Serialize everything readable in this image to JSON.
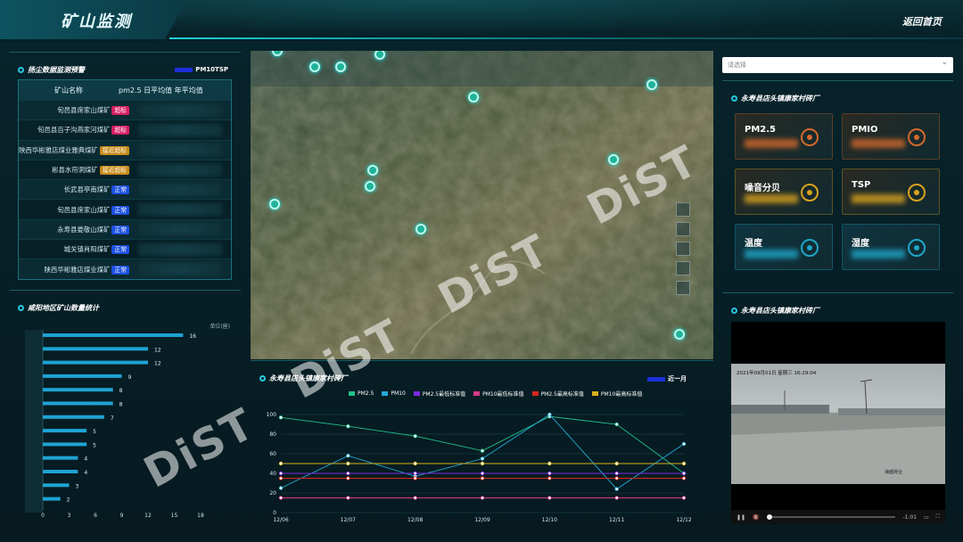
{
  "header": {
    "title": "矿山监测",
    "back_label": "返回首页"
  },
  "dust_panel": {
    "title": "扬尘数据监测预警",
    "legend": "PM10TSP",
    "columns": [
      "矿山名称",
      "pm2.5 日平均值 年平均值"
    ],
    "rows": [
      {
        "name": "旬邑县席家山煤矿",
        "status": "超标",
        "color": "red"
      },
      {
        "name": "旬邑县百子沟燕家河煤矿",
        "status": "超标",
        "color": "red"
      },
      {
        "name": "陕西华彬雅店煤业雅典煤矿",
        "status": "接近超标",
        "color": "gold"
      },
      {
        "name": "彬县水帘洞煤矿",
        "status": "接近超标",
        "color": "gold"
      },
      {
        "name": "长武县亭南煤矿",
        "status": "正常",
        "color": "blue"
      },
      {
        "name": "旬邑县席家山煤矿",
        "status": "正常",
        "color": "blue"
      },
      {
        "name": "永寿县娄敬山煤矿",
        "status": "正常",
        "color": "blue"
      },
      {
        "name": "城关镇肖阳煤矿",
        "status": "正常",
        "color": "blue"
      },
      {
        "name": "陕西华彬雅店煤业煤矿",
        "status": "正常",
        "color": "blue"
      }
    ]
  },
  "count_panel": {
    "title": "咸阳地区矿山数量统计",
    "unit": "单位(座)"
  },
  "line_panel": {
    "title": "永寿县店头镇康家村砖厂",
    "segment": "近一月"
  },
  "select": {
    "placeholder": "请选择"
  },
  "sensor_panel": {
    "title": "永寿县店头镇康家村砖厂",
    "cards": [
      {
        "label": "PM2.5",
        "accent": "#d2692d",
        "icon": "mask-icon"
      },
      {
        "label": "PMIO",
        "accent": "#d2692d",
        "icon": "eye-icon"
      },
      {
        "label": "噪音分贝",
        "accent": "#d9a21e",
        "icon": "sound-icon"
      },
      {
        "label": "TSP",
        "accent": "#d9a21e",
        "icon": "triangle-icon"
      },
      {
        "label": "温度",
        "accent": "#1fa6c9",
        "icon": "thermometer-icon"
      },
      {
        "label": "湿度",
        "accent": "#1fa6c9",
        "icon": "humidity-icon"
      }
    ]
  },
  "video_panel": {
    "title": "永寿县店头镇康家村砖厂",
    "timestamp": "2021年09月01日 星期三 16:29:04",
    "time_label": "-1:01",
    "caption": "海盛砖业"
  },
  "watermark": "DiST",
  "chart_data": [
    {
      "type": "bar",
      "orientation": "horizontal",
      "title": "咸阳地区矿山数量统计",
      "values": [
        16,
        12,
        12,
        9,
        8,
        8,
        7,
        5,
        5,
        4,
        4,
        3,
        2
      ],
      "xticks": [
        0,
        3,
        6,
        9,
        12,
        15,
        18
      ],
      "xlim": [
        0,
        18
      ],
      "unit": "单位(座)"
    },
    {
      "type": "line",
      "title": "永寿县店头镇康家村砖厂",
      "x": [
        "12/06",
        "12/07",
        "12/08",
        "12/09",
        "12/10",
        "12/11",
        "12/12"
      ],
      "ylim": [
        0,
        100
      ],
      "yticks": [
        0,
        20,
        40,
        60,
        80,
        100
      ],
      "series": [
        {
          "name": "PM2.5",
          "color": "#22c08a",
          "values": [
            97,
            88,
            78,
            63,
            98,
            90,
            40
          ]
        },
        {
          "name": "PM10",
          "color": "#25a9d6",
          "values": [
            25,
            58,
            37,
            55,
            100,
            24,
            70
          ]
        },
        {
          "name": "PM2.5最低标准值",
          "color": "#7b2be0",
          "values": [
            40,
            40,
            40,
            40,
            40,
            40,
            40
          ]
        },
        {
          "name": "PM10最低标准值",
          "color": "#d63a8c",
          "values": [
            15,
            15,
            15,
            15,
            15,
            15,
            15
          ]
        },
        {
          "name": "PM2.5最高标准值",
          "color": "#d9261d",
          "values": [
            35,
            35,
            35,
            35,
            35,
            35,
            35
          ]
        },
        {
          "name": "PM10最高标准值",
          "color": "#d6b21a",
          "values": [
            50,
            50,
            50,
            50,
            50,
            50,
            50
          ]
        }
      ]
    }
  ]
}
